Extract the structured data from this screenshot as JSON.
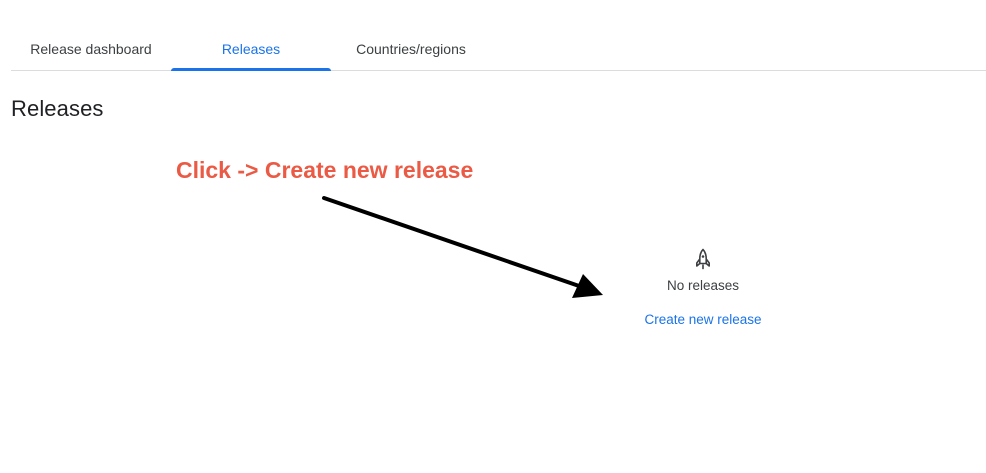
{
  "tabs": [
    {
      "label": "Release dashboard",
      "active": false
    },
    {
      "label": "Releases",
      "active": true
    },
    {
      "label": "Countries/regions",
      "active": false
    }
  ],
  "page": {
    "title": "Releases"
  },
  "annotation": {
    "text": "Click -> Create new release",
    "color": "#ea5a44"
  },
  "empty_state": {
    "icon": "rocket-icon",
    "message": "No releases",
    "action_label": "Create new release"
  },
  "colors": {
    "accent": "#1a73e8",
    "divider": "#dadce0",
    "text_primary": "#202124",
    "text_secondary": "#3c4043"
  }
}
